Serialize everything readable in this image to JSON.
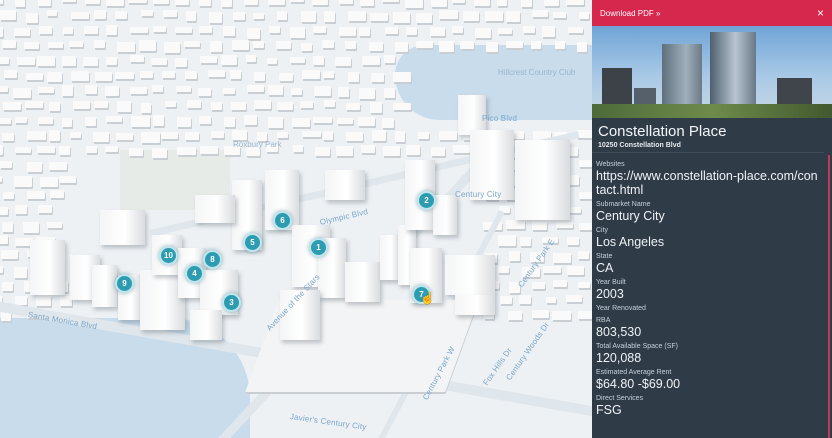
{
  "map": {
    "place_labels": [
      "Hillcrest Country Club",
      "Roxbury Park"
    ],
    "street_labels": [
      "Santa Monica Blvd",
      "Avenue of the Stars",
      "Century Park E",
      "Century Park W",
      "Olympic Blvd",
      "Pico Blvd",
      "Century Woods Dr",
      "Fox Hills Dr",
      "Javier's Century City",
      "Century City"
    ],
    "markers": [
      "1",
      "2",
      "3",
      "4",
      "5",
      "6",
      "7",
      "8",
      "9",
      "10"
    ],
    "colors": {
      "marker": "#2e9cb0",
      "water": "#c8dcec"
    }
  },
  "panel": {
    "download_label": "Download PDF »",
    "close_label": "×",
    "building_name": "Constellation Place",
    "address": "10250 Constellation Blvd",
    "fields": [
      {
        "label": "Websites",
        "value": "https://www.constellation-place.com/contact.html"
      },
      {
        "label": "Submarket Name",
        "value": "Century City"
      },
      {
        "label": "City",
        "value": "Los Angeles"
      },
      {
        "label": "State",
        "value": "CA"
      },
      {
        "label": "Year Built",
        "value": "2003"
      },
      {
        "label": "Year Renovated",
        "value": ""
      },
      {
        "label": "RBA",
        "value": "803,530"
      },
      {
        "label": "Total Available Space (SF)",
        "value": "120,088"
      },
      {
        "label": "Estimated Average Rent",
        "value": "$64.80 -$69.00"
      },
      {
        "label": "Direct Services",
        "value": "FSG"
      }
    ],
    "colors": {
      "header": "#d6274d",
      "background": "#2f3c48"
    }
  }
}
